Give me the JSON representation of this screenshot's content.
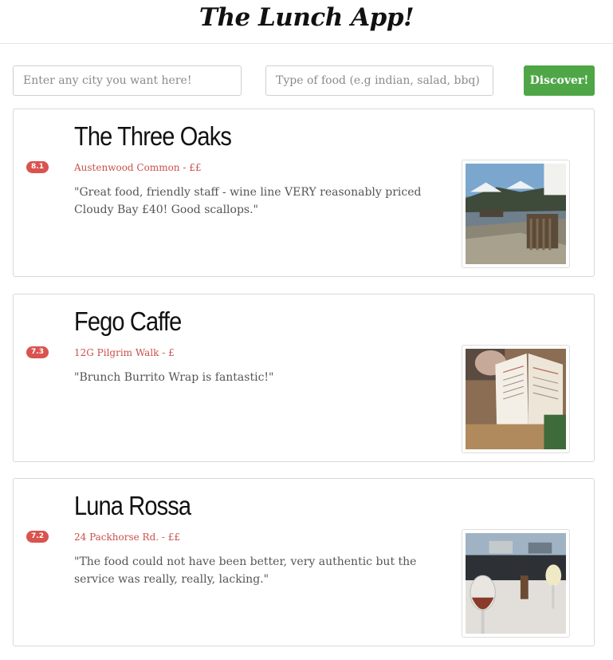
{
  "app": {
    "title": "The Lunch App!"
  },
  "search": {
    "city_placeholder": "Enter any city you want here!",
    "city_value": "",
    "food_placeholder": "Type of food (e.g indian, salad, bbq)",
    "food_value": "",
    "discover_label": "Discover!"
  },
  "restaurants": [
    {
      "name": "The Three Oaks",
      "rating": "8.1",
      "meta": "Austenwood Common - ££",
      "quote": "\"Great food, friendly staff - wine line VERY reasonably priced Cloudy Bay £40! Good scallops.\"",
      "photo": "terrace-photo"
    },
    {
      "name": "Fego Caffe",
      "rating": "7.3",
      "meta": "12G Pilgrim Walk - £",
      "quote": "\"Brunch Burrito Wrap is fantastic!\"",
      "photo": "menu-photo"
    },
    {
      "name": "Luna Rossa",
      "rating": "7.2",
      "meta": "24 Packhorse Rd. - ££",
      "quote": "\"The food could not have been better, very authentic but the service was really, really, lacking.\"",
      "photo": "wine-glass-photo"
    }
  ],
  "colors": {
    "accent_green": "#4ea646",
    "rating_red": "#d9534f",
    "meta_red": "#c9514a"
  }
}
